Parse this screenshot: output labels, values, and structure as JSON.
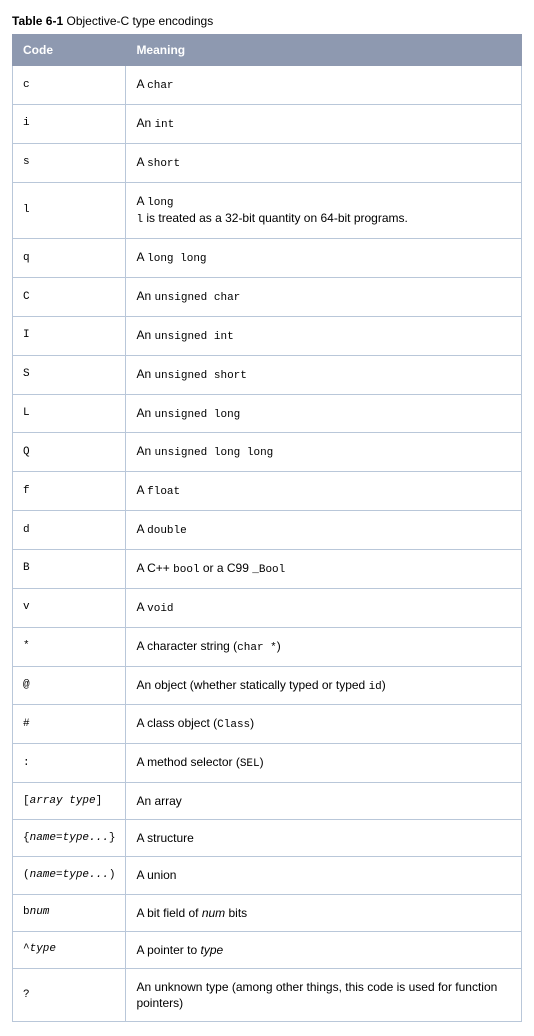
{
  "caption": {
    "label": "Table 6-1",
    "title": "Objective-C type encodings"
  },
  "headers": {
    "code": "Code",
    "meaning": "Meaning"
  },
  "rows": [
    {
      "code_segments": [
        {
          "t": "c",
          "cls": "mono"
        }
      ],
      "meaning_segments": [
        {
          "t": "A "
        },
        {
          "t": "char",
          "cls": "mono"
        }
      ]
    },
    {
      "code_segments": [
        {
          "t": "i",
          "cls": "mono"
        }
      ],
      "meaning_segments": [
        {
          "t": "An "
        },
        {
          "t": "int",
          "cls": "mono"
        }
      ]
    },
    {
      "code_segments": [
        {
          "t": "s",
          "cls": "mono"
        }
      ],
      "meaning_segments": [
        {
          "t": "A "
        },
        {
          "t": "short",
          "cls": "mono"
        }
      ]
    },
    {
      "code_segments": [
        {
          "t": "l",
          "cls": "mono"
        }
      ],
      "meaning_segments": [
        {
          "t": "A "
        },
        {
          "t": "long",
          "cls": "mono"
        },
        {
          "t": "",
          "br": true
        },
        {
          "t": "l",
          "cls": "mono"
        },
        {
          "t": " is treated as a 32-bit quantity on 64-bit programs."
        }
      ]
    },
    {
      "code_segments": [
        {
          "t": "q",
          "cls": "mono"
        }
      ],
      "meaning_segments": [
        {
          "t": "A "
        },
        {
          "t": "long long",
          "cls": "mono"
        }
      ]
    },
    {
      "code_segments": [
        {
          "t": "C",
          "cls": "mono"
        }
      ],
      "meaning_segments": [
        {
          "t": "An "
        },
        {
          "t": "unsigned char",
          "cls": "mono"
        }
      ]
    },
    {
      "code_segments": [
        {
          "t": "I",
          "cls": "mono"
        }
      ],
      "meaning_segments": [
        {
          "t": "An "
        },
        {
          "t": "unsigned int",
          "cls": "mono"
        }
      ]
    },
    {
      "code_segments": [
        {
          "t": "S",
          "cls": "mono"
        }
      ],
      "meaning_segments": [
        {
          "t": "An "
        },
        {
          "t": "unsigned short",
          "cls": "mono"
        }
      ]
    },
    {
      "code_segments": [
        {
          "t": "L",
          "cls": "mono"
        }
      ],
      "meaning_segments": [
        {
          "t": "An "
        },
        {
          "t": "unsigned long",
          "cls": "mono"
        }
      ]
    },
    {
      "code_segments": [
        {
          "t": "Q",
          "cls": "mono"
        }
      ],
      "meaning_segments": [
        {
          "t": "An "
        },
        {
          "t": "unsigned long long",
          "cls": "mono"
        }
      ]
    },
    {
      "code_segments": [
        {
          "t": "f",
          "cls": "mono"
        }
      ],
      "meaning_segments": [
        {
          "t": "A "
        },
        {
          "t": "float",
          "cls": "mono"
        }
      ]
    },
    {
      "code_segments": [
        {
          "t": "d",
          "cls": "mono"
        }
      ],
      "meaning_segments": [
        {
          "t": "A "
        },
        {
          "t": "double",
          "cls": "mono"
        }
      ]
    },
    {
      "code_segments": [
        {
          "t": "B",
          "cls": "mono"
        }
      ],
      "meaning_segments": [
        {
          "t": "A C++ "
        },
        {
          "t": "bool",
          "cls": "mono"
        },
        {
          "t": " or a C99 "
        },
        {
          "t": "_Bool",
          "cls": "mono"
        }
      ]
    },
    {
      "code_segments": [
        {
          "t": "v",
          "cls": "mono"
        }
      ],
      "meaning_segments": [
        {
          "t": "A "
        },
        {
          "t": "void",
          "cls": "mono"
        }
      ]
    },
    {
      "code_segments": [
        {
          "t": "*",
          "cls": "mono"
        }
      ],
      "meaning_segments": [
        {
          "t": "A character string ("
        },
        {
          "t": "char *",
          "cls": "mono"
        },
        {
          "t": ")"
        }
      ]
    },
    {
      "code_segments": [
        {
          "t": "@",
          "cls": "mono"
        }
      ],
      "meaning_segments": [
        {
          "t": "An object (whether statically typed or typed "
        },
        {
          "t": "id",
          "cls": "mono"
        },
        {
          "t": ")"
        }
      ]
    },
    {
      "code_segments": [
        {
          "t": "#",
          "cls": "mono"
        }
      ],
      "meaning_segments": [
        {
          "t": "A class object ("
        },
        {
          "t": "Class",
          "cls": "mono"
        },
        {
          "t": ")"
        }
      ]
    },
    {
      "code_segments": [
        {
          "t": ":",
          "cls": "mono"
        }
      ],
      "meaning_segments": [
        {
          "t": "A method selector ("
        },
        {
          "t": "SEL",
          "cls": "mono"
        },
        {
          "t": ")"
        }
      ]
    },
    {
      "code_segments": [
        {
          "t": "["
        },
        {
          "t": "array type",
          "cls": "ital"
        },
        {
          "t": "]"
        }
      ],
      "meaning_segments": [
        {
          "t": "An array"
        }
      ]
    },
    {
      "code_segments": [
        {
          "t": "{"
        },
        {
          "t": "name=type...",
          "cls": "ital"
        },
        {
          "t": "}"
        }
      ],
      "meaning_segments": [
        {
          "t": "A structure"
        }
      ]
    },
    {
      "code_segments": [
        {
          "t": "("
        },
        {
          "t": "name=type...",
          "cls": "ital"
        },
        {
          "t": ")"
        }
      ],
      "meaning_segments": [
        {
          "t": "A union"
        }
      ]
    },
    {
      "code_segments": [
        {
          "t": "b",
          "cls": "mono"
        },
        {
          "t": "num",
          "cls": "ital"
        }
      ],
      "meaning_segments": [
        {
          "t": "A bit field of "
        },
        {
          "t": "num",
          "cls": "ital"
        },
        {
          "t": " bits"
        }
      ]
    },
    {
      "code_segments": [
        {
          "t": "^",
          "cls": "mono"
        },
        {
          "t": "type",
          "cls": "ital"
        }
      ],
      "meaning_segments": [
        {
          "t": "A pointer to "
        },
        {
          "t": "type",
          "cls": "ital"
        }
      ]
    },
    {
      "code_segments": [
        {
          "t": "?",
          "cls": "mono"
        }
      ],
      "meaning_segments": [
        {
          "t": "An unknown type (among other things, this code is used for function pointers)"
        }
      ]
    }
  ]
}
